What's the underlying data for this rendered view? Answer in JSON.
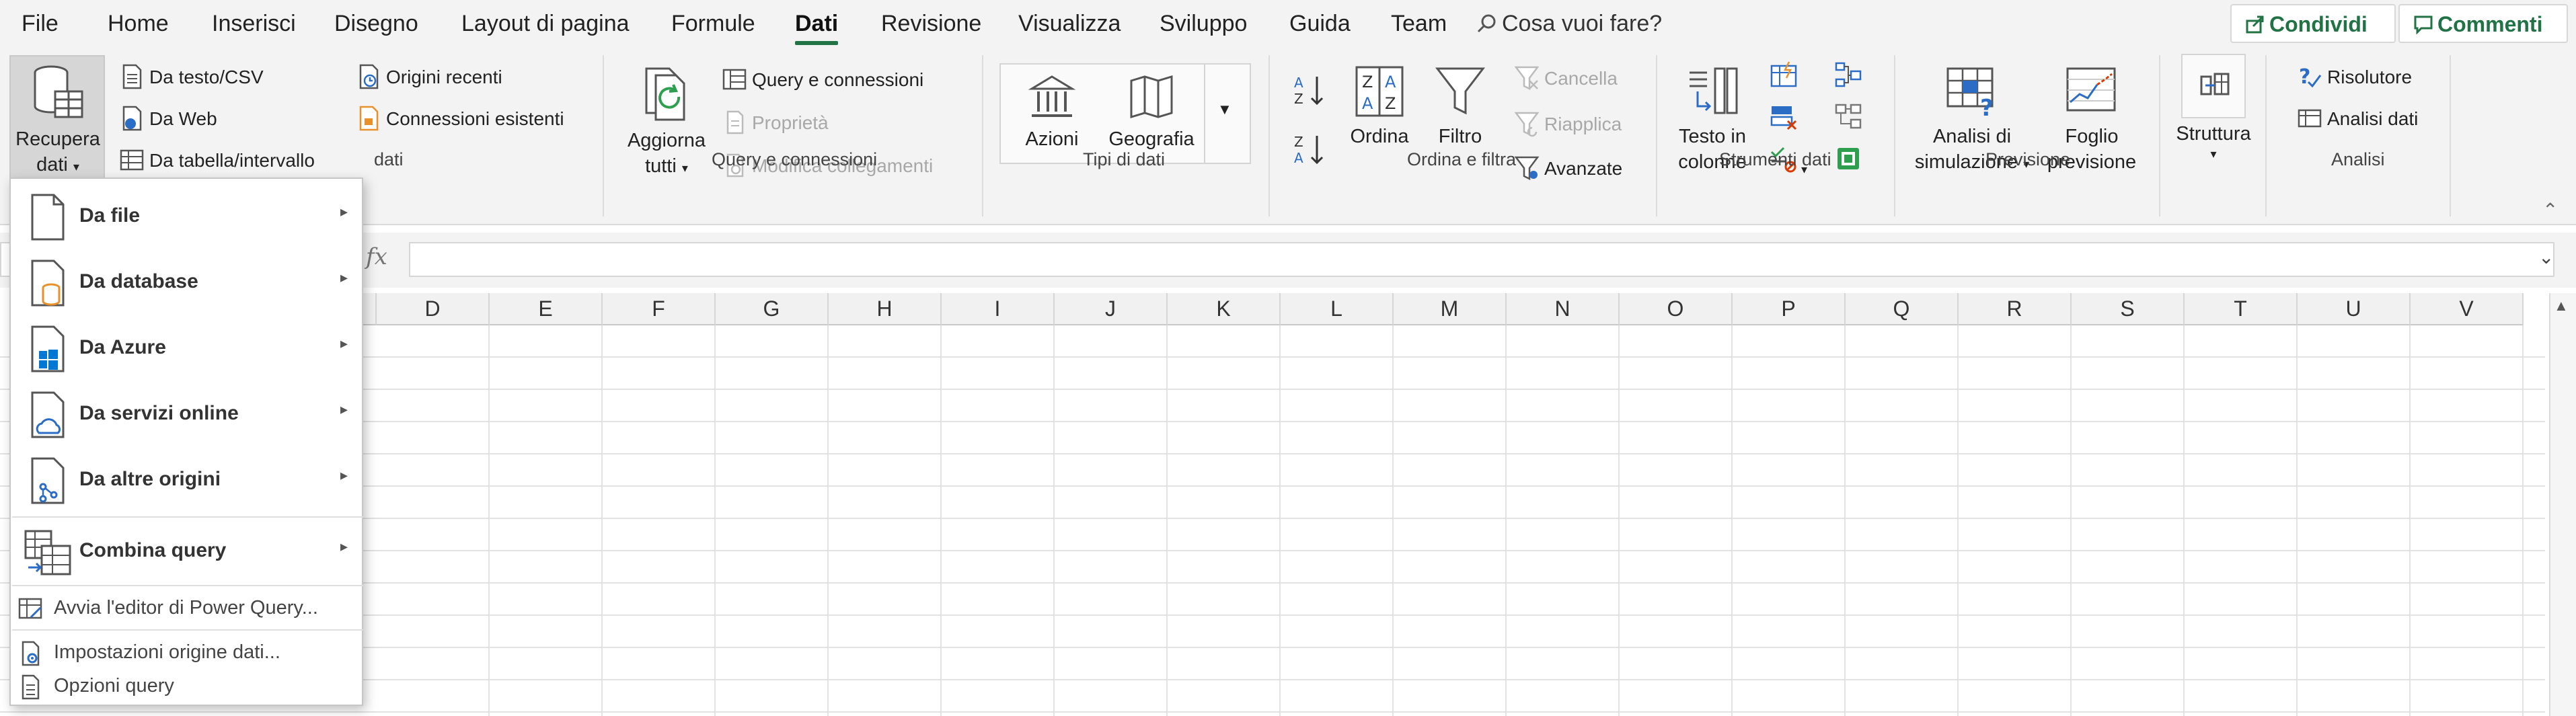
{
  "menu": {
    "tabs": [
      {
        "label": "File"
      },
      {
        "label": "Home"
      },
      {
        "label": "Inserisci"
      },
      {
        "label": "Disegno"
      },
      {
        "label": "Layout di pagina"
      },
      {
        "label": "Formule"
      },
      {
        "label": "Dati"
      },
      {
        "label": "Revisione"
      },
      {
        "label": "Visualizza"
      },
      {
        "label": "Sviluppo"
      },
      {
        "label": "Guida"
      },
      {
        "label": "Team"
      }
    ],
    "active_tab": "Dati",
    "tell_me": "Cosa vuoi fare?",
    "share": "Condividi",
    "comments": "Commenti"
  },
  "ribbon": {
    "get_data": {
      "recupera": "Recupera dati",
      "recupera_line1": "Recupera",
      "recupera_line2": "dati",
      "da_testo": "Da testo/CSV",
      "da_web": "Da Web",
      "da_tabella": "Da tabella/intervallo",
      "origini_recenti": "Origini recenti",
      "connessioni_esistenti": "Connessioni esistenti",
      "group_label_visible": "dati"
    },
    "query": {
      "aggiorna_line1": "Aggiorna",
      "aggiorna_line2": "tutti",
      "query_connessioni": "Query e connessioni",
      "proprieta": "Proprietà",
      "modifica_collegamenti": "Modifica collegamenti",
      "group_label": "Query e connessioni"
    },
    "tipi": {
      "azioni": "Azioni",
      "geografia": "Geografia",
      "group_label": "Tipi di dati"
    },
    "ordina": {
      "ordina": "Ordina",
      "filtro": "Filtro",
      "cancella": "Cancella",
      "riapplica": "Riapplica",
      "avanzate": "Avanzate",
      "group_label": "Ordina e filtra"
    },
    "strumenti": {
      "testo_line1": "Testo in",
      "testo_line2": "colonne",
      "group_label": "Strumenti dati"
    },
    "previsione": {
      "analisi_line1": "Analisi di",
      "analisi_line2": "simulazione",
      "foglio_line1": "Foglio",
      "foglio_line2": "previsione",
      "group_label": "Previsione"
    },
    "struttura": {
      "label": "Struttura"
    },
    "analisi": {
      "risolutore": "Risolutore",
      "analisi_dati": "Analisi dati",
      "group_label": "Analisi"
    }
  },
  "formula_bar": {
    "fx": "fx"
  },
  "columns": [
    "D",
    "E",
    "F",
    "G",
    "H",
    "I",
    "J",
    "K",
    "L",
    "M",
    "N",
    "O",
    "P",
    "Q",
    "R",
    "S",
    "T",
    "U",
    "V"
  ],
  "dropdown": {
    "items": [
      {
        "label": "Da file"
      },
      {
        "label": "Da database"
      },
      {
        "label": "Da Azure"
      },
      {
        "label": "Da servizi online"
      },
      {
        "label": "Da altre origini"
      },
      {
        "label": "Combina query"
      }
    ],
    "small_items": [
      {
        "label": "Avvia l'editor di Power Query..."
      },
      {
        "label": "Impostazioni origine dati..."
      },
      {
        "label": "Opzioni query"
      }
    ]
  },
  "colors": {
    "accent": "#217346",
    "ribbon_bg": "#f3f3f3",
    "icon_blue": "#2b6cc4",
    "icon_orange": "#e8912b"
  }
}
